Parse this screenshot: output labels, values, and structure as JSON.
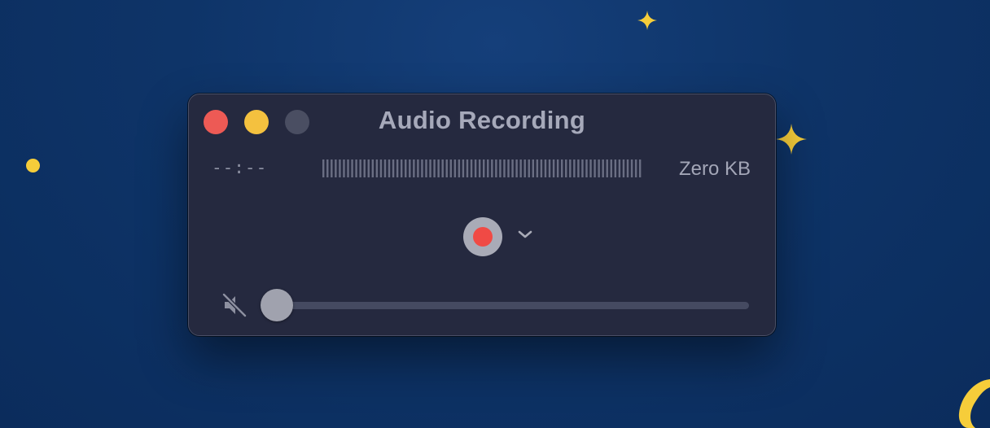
{
  "window": {
    "title": "Audio Recording"
  },
  "traffic_lights": [
    {
      "name": "close",
      "color": "#ed5a55"
    },
    {
      "name": "minimize",
      "color": "#f4c13f"
    },
    {
      "name": "zoom",
      "color": "#4a4e62",
      "state": "disabled"
    }
  ],
  "status": {
    "time": "--:--",
    "file_size": "Zero KB"
  },
  "controls": {
    "record_icon": "record-icon",
    "options_icon": "chevron-down-icon",
    "volume_icon": "speaker-muted-icon",
    "volume_level": 0
  },
  "colors": {
    "background": "#0e3468",
    "window": "#25293f",
    "record": "#f04a45",
    "star": "#f6cd3a"
  }
}
